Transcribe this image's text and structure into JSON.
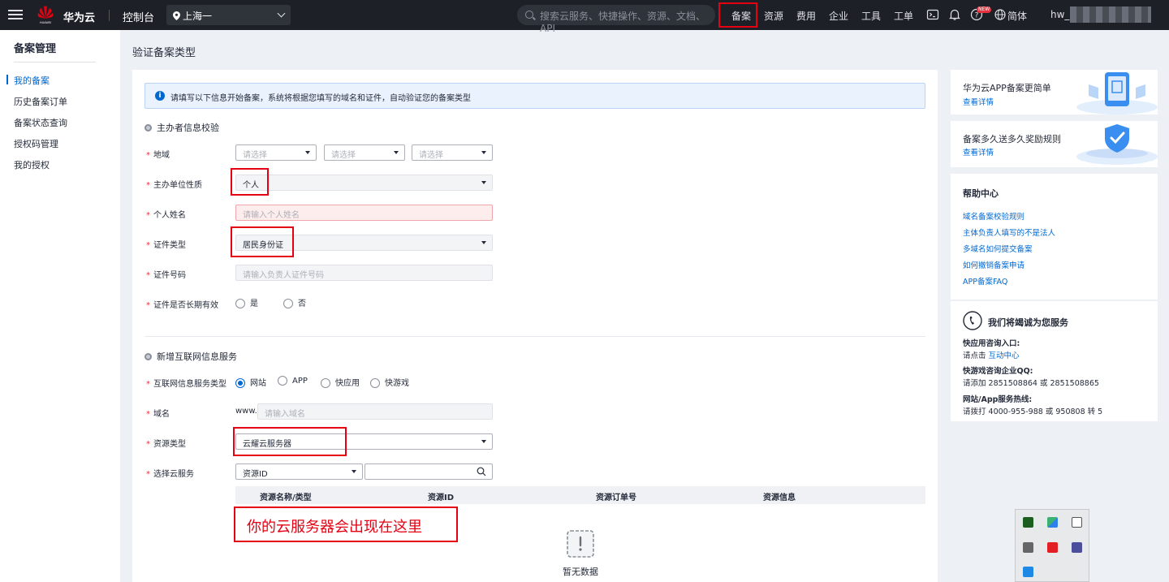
{
  "topbar": {
    "logo_alt": "HUAWEI",
    "logo_text": "华为云",
    "console": "控制台",
    "region": "上海一",
    "search_placeholder": "搜索云服务、快捷操作、资源、文档、API",
    "nav": [
      "备案",
      "资源",
      "费用",
      "企业",
      "工具",
      "工单"
    ],
    "new_badge": "NEW",
    "language": "简体",
    "username": "hw_"
  },
  "sidebar": {
    "title": "备案管理",
    "items": [
      "我的备案",
      "历史备案订单",
      "备案状态查询",
      "授权码管理",
      "我的授权"
    ]
  },
  "page": {
    "title": "验证备案类型",
    "info": "请填写以下信息开始备案，系统将根据您填写的域名和证件，自动验证您的备案类型"
  },
  "section1": {
    "title": "主办者信息校验",
    "region_label": "地域",
    "region_placeholders": [
      "请选择",
      "请选择",
      "请选择"
    ],
    "org_type_label": "主办单位性质",
    "org_type_value": "个人",
    "name_label": "个人姓名",
    "name_placeholder": "请输入个人姓名",
    "cert_type_label": "证件类型",
    "cert_type_value": "居民身份证",
    "cert_no_label": "证件号码",
    "cert_no_placeholder": "请输入负责人证件号码",
    "long_term_label": "证件是否长期有效",
    "long_term_options": [
      "是",
      "否"
    ]
  },
  "section2": {
    "title": "新增互联网信息服务",
    "service_type_label": "互联网信息服务类型",
    "service_types": [
      "网站",
      "APP",
      "快应用",
      "快游戏"
    ],
    "domain_label": "域名",
    "domain_prefix": "www.",
    "domain_placeholder": "请输入域名",
    "resource_type_label": "资源类型",
    "resource_type_value": "云耀云服务器",
    "cloud_service_label": "选择云服务",
    "cloud_service_filter": "资源ID",
    "table_columns": [
      "资源名称/类型",
      "资源ID",
      "资源订单号",
      "资源信息"
    ],
    "annotation": "你的云服务器会出现在这里",
    "empty_text": "暂无数据"
  },
  "right": {
    "promo1_title": "华为云APP备案更简单",
    "promo1_link": "查看详情",
    "promo2_title": "备案多久送多久奖励规则",
    "promo2_link": "查看详情",
    "help_title": "帮助中心",
    "help_links": [
      "域名备案校验规则",
      "主体负责人填写的不是法人",
      "多域名如何提交备案",
      "如何撤销备案申请",
      "APP备案FAQ"
    ],
    "service_title": "我们将竭诚为您服务",
    "quick_label": "快应用咨询入口:",
    "quick_prefix": "请点击",
    "quick_link": "互动中心",
    "qq_label": "快游戏咨询企业QQ:",
    "qq_text": "请添加 2851508864 或 2851508865",
    "hotline_label": "网站/App服务热线:",
    "hotline_text": "请拨打 4000-955-988 或 950808 转 5"
  }
}
